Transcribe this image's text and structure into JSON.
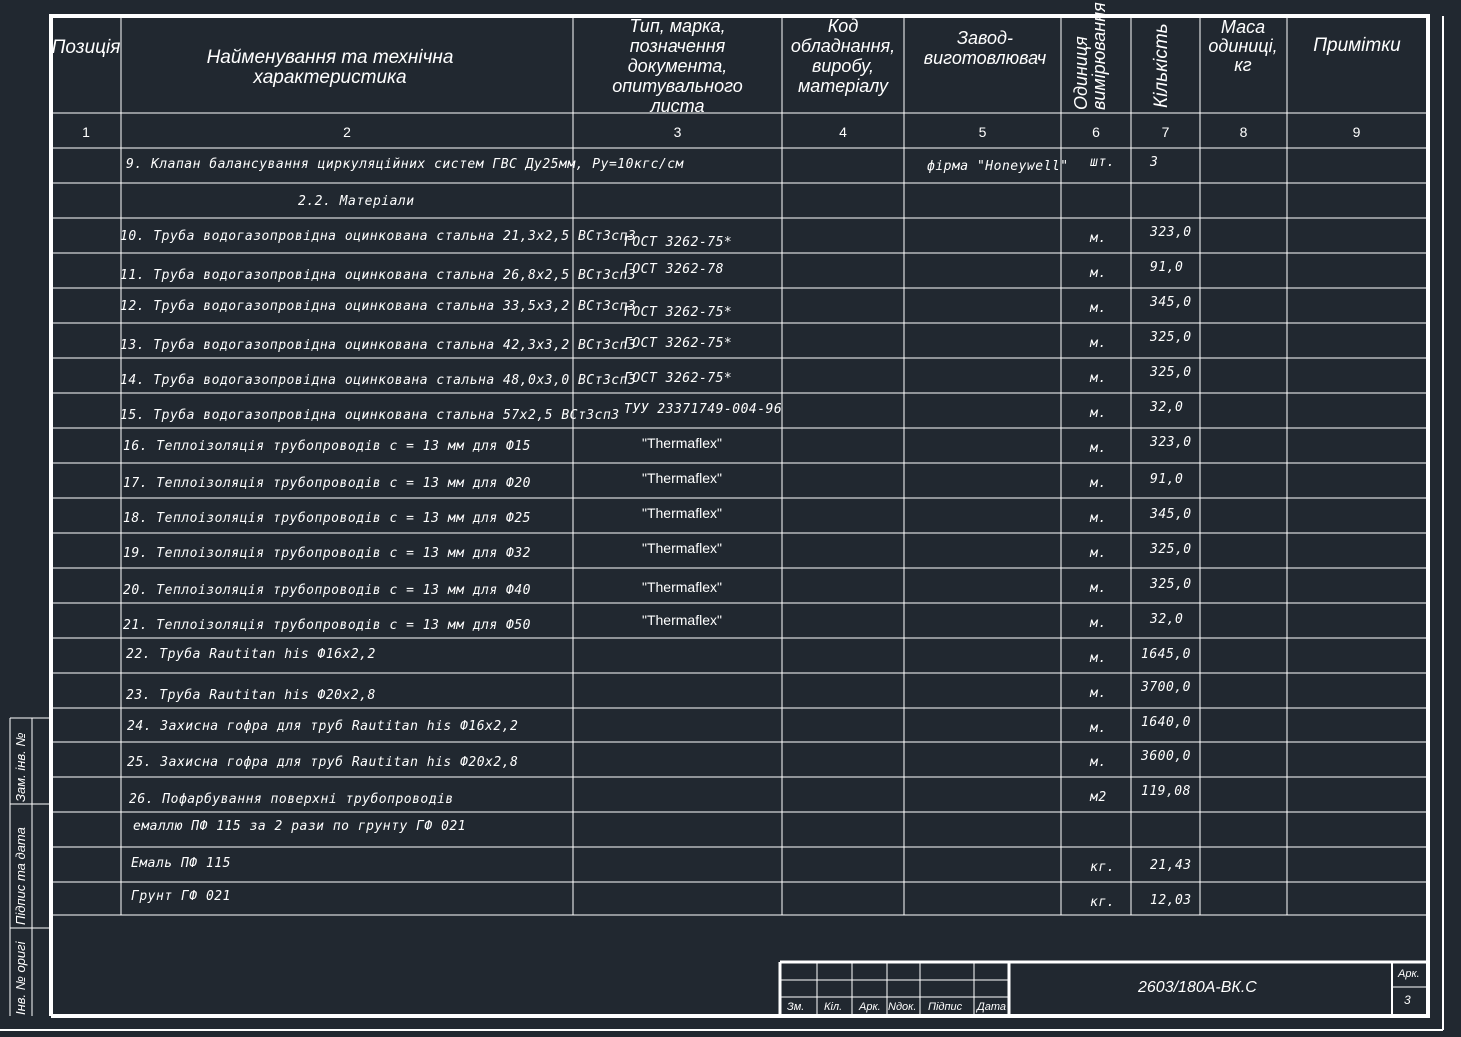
{
  "header": {
    "position": "Позиція",
    "name": "Найменування та технічна характеристика",
    "type": "Тип, марка, позначення документа, опитувального листа",
    "code": "Код обладнання, виробу, матеріалу",
    "manufacturer": "Завод- виготовлювач",
    "unit": "Одиниця вимірювання",
    "quantity": "Кількість",
    "mass": "Маса одиниці, кг",
    "notes": "Примітки"
  },
  "column_numbers": [
    "1",
    "2",
    "3",
    "4",
    "5",
    "6",
    "7",
    "8",
    "9"
  ],
  "rows": [
    {
      "name": "9. Клапан балансування циркуляційних систем ГВС Ду25мм, Ру=10кгс/см",
      "type": "",
      "manufacturer": "фірма \"Honeywell\"",
      "unit": "шт.",
      "qty": "3"
    },
    {
      "name": "2.2. Матеріали",
      "type": "",
      "manufacturer": "",
      "unit": "",
      "qty": ""
    },
    {
      "name": "10. Труба водогазопровідна оцинкована стальна 21,3х2,5 ВСт3сп3",
      "type": "ГОСТ 3262-75*",
      "manufacturer": "",
      "unit": "м.",
      "qty": "323,0"
    },
    {
      "name": "11. Труба водогазопровідна оцинкована стальна 26,8х2,5 ВСт3сп3",
      "type": "ГОСТ 3262-78",
      "manufacturer": "",
      "unit": "м.",
      "qty": "91,0"
    },
    {
      "name": "12. Труба водогазопровідна оцинкована стальна 33,5х3,2 ВСт3сп3",
      "type": "ГОСТ 3262-75*",
      "manufacturer": "",
      "unit": "м.",
      "qty": "345,0"
    },
    {
      "name": "13. Труба водогазопровідна оцинкована стальна 42,3х3,2 ВСт3сп3",
      "type": "ГОСТ 3262-75*",
      "manufacturer": "",
      "unit": "м.",
      "qty": "325,0"
    },
    {
      "name": "14. Труба водогазопровідна оцинкована стальна 48,0х3,0 ВСт3сп3",
      "type": "ГОСТ 3262-75*",
      "manufacturer": "",
      "unit": "м.",
      "qty": "325,0"
    },
    {
      "name": "15. Труба водогазопровідна оцинкована стальна 57х2,5 ВСт3сп3",
      "type": "ТУУ 23371749-004-96",
      "manufacturer": "",
      "unit": "м.",
      "qty": "32,0"
    },
    {
      "name": "16. Теплоізоляція трубопроводів  с = 13 мм для Ф15",
      "type": "\"Thermaflex\"",
      "manufacturer": "",
      "unit": "м.",
      "qty": "323,0"
    },
    {
      "name": "17. Теплоізоляція трубопроводів  с = 13 мм для Ф20",
      "type": "\"Thermaflex\"",
      "manufacturer": "",
      "unit": "м.",
      "qty": "91,0"
    },
    {
      "name": "18. Теплоізоляція трубопроводів  с = 13 мм для Ф25",
      "type": "\"Thermaflex\"",
      "manufacturer": "",
      "unit": "м.",
      "qty": "345,0"
    },
    {
      "name": "19. Теплоізоляція трубопроводів  с = 13 мм для Ф32",
      "type": "\"Thermaflex\"",
      "manufacturer": "",
      "unit": "м.",
      "qty": "325,0"
    },
    {
      "name": "20. Теплоізоляція трубопроводів  с = 13 мм для Ф40",
      "type": "\"Thermaflex\"",
      "manufacturer": "",
      "unit": "м.",
      "qty": "325,0"
    },
    {
      "name": "21. Теплоізоляція трубопроводів  с = 13 мм для Ф50",
      "type": "\"Thermaflex\"",
      "manufacturer": "",
      "unit": "м.",
      "qty": "32,0"
    },
    {
      "name": "22. Труба Rautitan his Ф16х2,2",
      "type": "",
      "manufacturer": "",
      "unit": "м.",
      "qty": "1645,0"
    },
    {
      "name": "23. Труба Rautitan his Ф20х2,8",
      "type": "",
      "manufacturer": "",
      "unit": "м.",
      "qty": "3700,0"
    },
    {
      "name": "24. Захисна гофра для труб Rautitan his Ф16х2,2",
      "type": "",
      "manufacturer": "",
      "unit": "м.",
      "qty": "1640,0"
    },
    {
      "name": "25. Захисна гофра для труб Rautitan his Ф20х2,8",
      "type": "",
      "manufacturer": "",
      "unit": "м.",
      "qty": "3600,0"
    },
    {
      "name": "26. Пофарбування поверхні трубопроводів",
      "type": "",
      "manufacturer": "",
      "unit": "м2",
      "qty": "119,08"
    },
    {
      "name": "емаллю ПФ 115 за 2 рази по грунту ГФ 021",
      "type": "",
      "manufacturer": "",
      "unit": "",
      "qty": ""
    },
    {
      "name": "Емаль ПФ 115",
      "type": "",
      "manufacturer": "",
      "unit": "кг.",
      "qty": "21,43"
    },
    {
      "name": "Грунт ГФ 021",
      "type": "",
      "manufacturer": "",
      "unit": "кг.",
      "qty": "12,03"
    }
  ],
  "side_stamp": {
    "inv_replace": "Зам. інв. №",
    "sign_date": "Підпис та дата",
    "inv_orig": "Інв. № оригі"
  },
  "title_block": {
    "zm": "Зм.",
    "kil": "Кіл.",
    "ark": "Арк.",
    "ndok": "Nдок.",
    "pidpys": "Підпис",
    "data": "Дата",
    "doc_code": "2603/180А-ВК.С",
    "sheet_label": "Арк.",
    "sheet_num": "3"
  },
  "colors": {
    "background": "#212830",
    "lines": "#ffffff"
  }
}
